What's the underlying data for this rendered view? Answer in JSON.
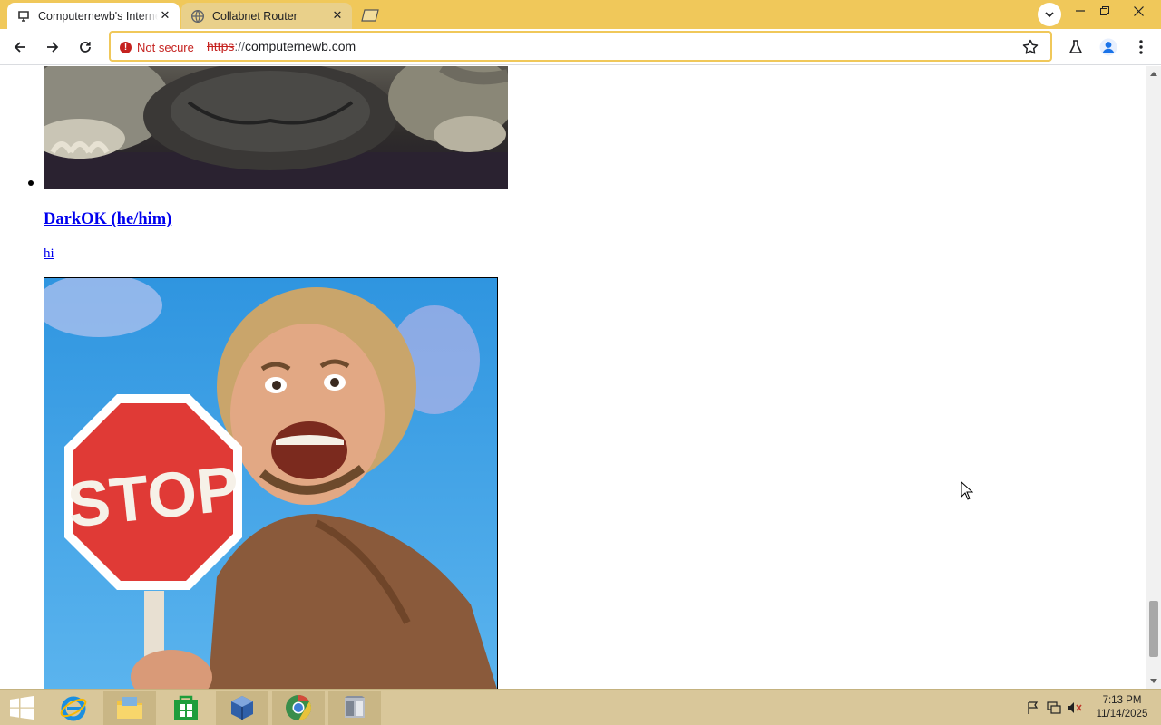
{
  "browser": {
    "tabs": [
      {
        "title": "Computernewb's Internet",
        "icon": "site-favicon-icon",
        "active": true
      },
      {
        "title": "Collabnet Router",
        "icon": "globe-icon",
        "active": false
      }
    ],
    "security_label": "Not secure",
    "url_scheme": "https",
    "url_separator": "://",
    "url_host": "computernewb.com",
    "accent_color": "#f0c85a"
  },
  "page": {
    "post": {
      "author": "DarkOK (he/him)",
      "text": "hi"
    },
    "images": [
      {
        "name": "dog-photo",
        "description_icon": "photo-image"
      },
      {
        "name": "stop-sign-gif",
        "description_icon": "photo-image"
      }
    ]
  },
  "taskbar": {
    "apps": [
      "internet-explorer-icon",
      "file-explorer-icon",
      "store-icon",
      "virtualbox-icon",
      "chrome-icon",
      "app-icon"
    ],
    "time": "7:13 PM",
    "date": "11/14/2025"
  }
}
